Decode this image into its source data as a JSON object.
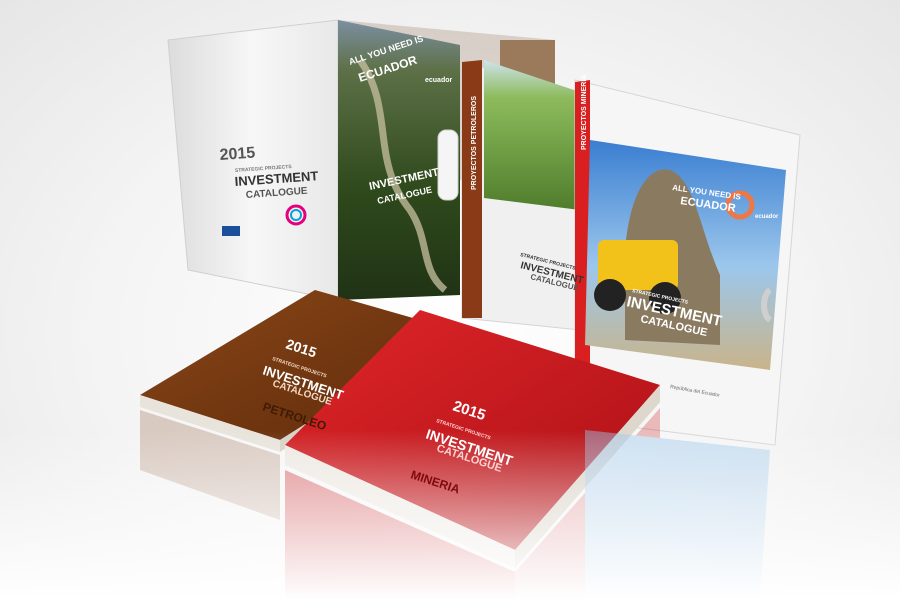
{
  "scene": {
    "description_text": "",
    "colors": {
      "petroleo_brown": "#7a3a12",
      "mineria_red": "#c8161b",
      "white_folder": "#f2f2f2",
      "accent_red_strip": "#d91f1f"
    }
  },
  "folder": {
    "year": "2015",
    "small_line": "STRATEGIC PROJECTS",
    "title": "INVESTMENT",
    "subtitle": "CATALOGUE"
  },
  "inner_cover": {
    "slogan_top": "ALL YOU NEED IS",
    "slogan_bottom": "ECUADOR",
    "logo_text": "ecuador",
    "title": "INVESTMENT",
    "subtitle": "CATALOGUE"
  },
  "booklet_petroleros": {
    "spine_label": "PROYECTOS PETROLEROS",
    "line1": "STRATEGIC PROJECTS",
    "title": "INVESTMENT",
    "subtitle": "CATALOGUE"
  },
  "booklet_mineria": {
    "spine_label": "PROYECTOS MINERIA",
    "slogan_top": "ALL YOU NEED IS",
    "slogan_bottom": "ECUADOR",
    "logo_text": "ecuador",
    "line1": "STRATEGIC PROJECTS",
    "title": "INVESTMENT",
    "subtitle": "CATALOGUE",
    "footer": "República del Ecuador"
  },
  "book_brown": {
    "year": "2015",
    "line1": "STRATEGIC PROJECTS",
    "title": "INVESTMENT",
    "subtitle": "CATALOGUE",
    "sector": "PETROLEO"
  },
  "book_red": {
    "year": "2015",
    "line1": "STRATEGIC PROJECTS",
    "title": "INVESTMENT",
    "subtitle": "CATALOGUE",
    "sector": "MINERIA"
  }
}
